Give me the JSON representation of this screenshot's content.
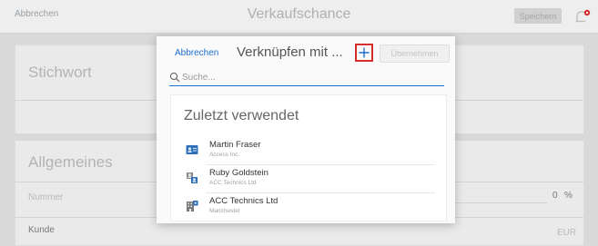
{
  "background": {
    "header": {
      "cancel_label": "Abbrechen",
      "title": "Verkaufschance",
      "save_label": "Speichern"
    },
    "keyword_card": {
      "title": "Stichwort"
    },
    "general_card": {
      "title": "Allgemeines",
      "number_label": "Nummer",
      "percent_value": "0",
      "percent_unit": "%",
      "customer_label": "Kunde",
      "currency": "EUR"
    }
  },
  "modal": {
    "cancel_label": "Abbrechen",
    "title": "Verknüpfen mit ...",
    "accept_label": "Übernehmen",
    "search": {
      "placeholder": "Suche..."
    },
    "recent": {
      "title": "Zuletzt verwendet",
      "items": [
        {
          "name": "Martin Fraser",
          "subtitle": "Access Inc.",
          "icon": "contact-card-icon"
        },
        {
          "name": "Ruby Goldstein",
          "subtitle": "ACC Technics Ltd",
          "icon": "contact-person-icon"
        },
        {
          "name": "ACC Technics Ltd",
          "subtitle": "Manchester",
          "icon": "company-building-icon"
        }
      ]
    }
  },
  "colors": {
    "accent": "#1f6fd0",
    "highlight": "#d32f2f"
  }
}
